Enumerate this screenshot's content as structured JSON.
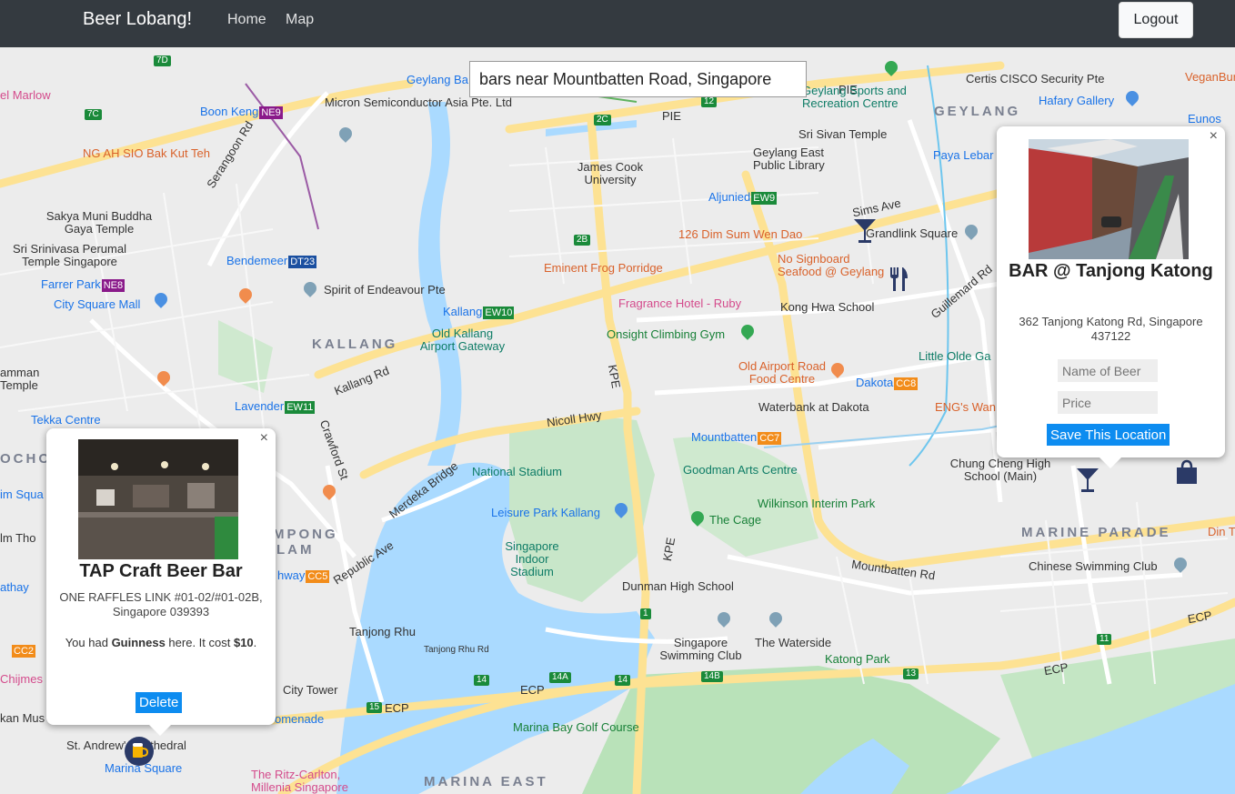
{
  "navbar": {
    "brand": "Beer Lobang!",
    "links": [
      "Home",
      "Map"
    ],
    "logout": "Logout"
  },
  "search": {
    "value": "bars near Mountbatten Road, Singapore"
  },
  "map": {
    "districts": [
      "GEYLANG",
      "KALLANG",
      "MARINE PARADE",
      "MARINA EAST",
      "OCHO",
      "MPONG",
      "LAM"
    ],
    "roads": [
      "Serangoon Rd",
      "Kallang Rd",
      "Crawford St",
      "Merdeka Bridge",
      "Republic Ave",
      "Nicoll Hwy",
      "Mountbatten Rd",
      "Guillemard Rd",
      "Sims Ave",
      "PIE",
      "KPE",
      "ECP",
      "Tanjong Rhu Rd"
    ],
    "places": {
      "geylang_ba": "Geylang Ba",
      "micron": "Micron Semiconductor Asia Pte. Ltd",
      "james_cook": "James Cook University",
      "geylang_sports": "Geylang Sports and Recreation Centre",
      "certis": "Certis CISCO Security Pte",
      "hafary": "Hafary Gallery",
      "veganburg": "VeganBurg S",
      "eunos": "Eunos",
      "sri_sivan": "Sri Sivan Temple",
      "geylang_east_lib": "Geylang East Public Library",
      "paya_lebar": "Paya Lebar",
      "aljunied": "Aljunied",
      "dim_sum": "126 Dim Sum Wen Dao",
      "grandlink": "Grandlink Square",
      "eminent_frog": "Eminent Frog Porridge",
      "no_signboard": "No Signboard Seafood @ Geylang",
      "fragrance": "Fragrance Hotel - Ruby",
      "kong_hwa": "Kong Hwa School",
      "kallang_mrt": "Kallang",
      "old_kallang": "Old Kallang Airport Gateway",
      "onsight": "Onsight Climbing Gym",
      "little_olde": "Little Olde Ga",
      "old_airport": "Old Airport Road Food Centre",
      "dakota": "Dakota",
      "waterbank": "Waterbank at Dakota",
      "engs": "ENG's Wan",
      "mountbatten": "Mountbatten",
      "chung_cheng": "Chung Cheng High School (Main)",
      "boon_keng": "Boon Keng",
      "ng_ah_sio": "NG AH SIO Bak Kut Teh",
      "sakya": "Sakya Muni Buddha Gaya Temple",
      "sri_srinivasa": "Sri Srinivasa Perumal Temple Singapore",
      "bendemeer": "Bendemeer",
      "farrer_park": "Farrer Park",
      "city_square": "City Square Mall",
      "spirit": "Spirit of Endeavour Pte",
      "marlow": "el Marlow",
      "lavender": "Lavender",
      "tekka": "Tekka Centre",
      "amman": "amman Temple",
      "national_stadium": "National Stadium",
      "goodman": "Goodman Arts Centre",
      "wilkinson": "Wilkinson Interim Park",
      "the_cage": "The Cage",
      "leisure_park": "Leisure Park Kallang",
      "sg_indoor": "Singapore Indoor Stadium",
      "dunman": "Dunman High School",
      "chinese_swimming": "Chinese Swimming Club",
      "tanjong_rhu": "Tanjong Rhu",
      "sg_swimming": "Singapore Swimming Club",
      "waterside": "The Waterside",
      "katong_park": "Katong Park",
      "city_tower": "City Tower",
      "marina_bay_golf": "Marina Bay Golf Course",
      "st_andrews": "St. Andrew's Cathedral",
      "marina_square": "Marina Square",
      "ritz": "The Ritz-Carlton, Millenia Singapore",
      "chijmes": "Chijmes",
      "kan_mus": "kan Mus",
      "im_squa": "im Squa",
      "im_tho": "lm Tho",
      "athay": "athay",
      "hway": "hway",
      "omenade": "omenade",
      "din_t": "Din T"
    },
    "mrt_badges": {
      "ne9": "NE9",
      "ne8": "NE8",
      "dt23": "DT23",
      "ew10": "EW10",
      "ew9": "EW9",
      "ew11": "EW11",
      "cc7": "CC7",
      "cc8": "CC8",
      "cc5": "CC5",
      "cc2": "CC2"
    },
    "shields": [
      "7D",
      "7C",
      "2C",
      "12",
      "2B",
      "1",
      "14A",
      "14",
      "14B",
      "13",
      "15",
      "11"
    ]
  },
  "infowindow_saved": {
    "title": "TAP Craft Beer Bar",
    "address": "ONE RAFFLES LINK #01-02/#01-02B, Singapore 039393",
    "had_prefix": "You had ",
    "beer": "Guinness",
    "had_mid": " here. It cost ",
    "price": "$10",
    "had_suffix": ".",
    "delete": "Delete",
    "close": "×"
  },
  "infowindow_new": {
    "title": "BAR @ Tanjong Katong",
    "address": "362 Tanjong Katong Rd, Singapore 437122",
    "beer_placeholder": "Name of Beer",
    "price_placeholder": "Price",
    "save": "Save This Location",
    "close": "×"
  },
  "colors": {
    "navbar": "#343a40",
    "button_blue": "#0d8cf0",
    "water": "#aadaff",
    "park": "#c5e8c5",
    "highway": "#fde293",
    "marker_navy": "#2b3a67"
  }
}
